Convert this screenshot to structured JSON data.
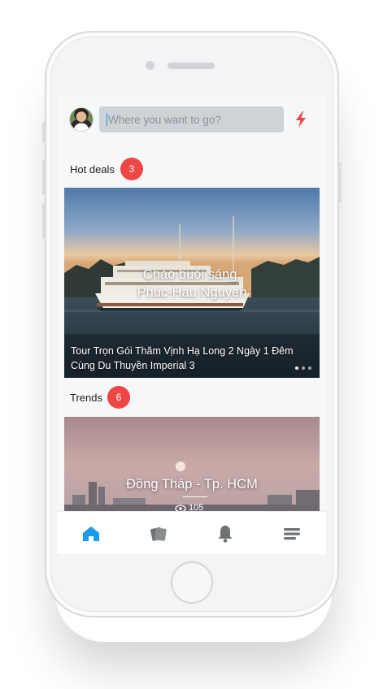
{
  "search": {
    "placeholder": "Where you want to go?"
  },
  "hot_deals": {
    "label": "Hot deals",
    "count": "3",
    "card": {
      "greeting_line1": "Chào buổi sáng,",
      "greeting_line2": "Phuc-Hau Nguyen",
      "caption": "Tour Trọn Gói Thăm Vịnh Hạ Long 2 Ngày 1 Đêm Cùng Du Thuyền Imperial 3"
    }
  },
  "trends": {
    "label": "Trends",
    "count": "6",
    "card": {
      "title": "Đồng Tháp - Tp. HCM",
      "views": "105"
    }
  },
  "tabbar": {
    "items": [
      {
        "name": "home",
        "icon": "home-icon",
        "active": true
      },
      {
        "name": "cards",
        "icon": "cards-icon",
        "active": false
      },
      {
        "name": "notifications",
        "icon": "bell-icon",
        "active": false
      },
      {
        "name": "menu",
        "icon": "menu-icon",
        "active": false
      }
    ]
  },
  "colors": {
    "accent": "#1a9be8",
    "badge": "#ee4645",
    "inactive_icon": "#6f7275"
  }
}
